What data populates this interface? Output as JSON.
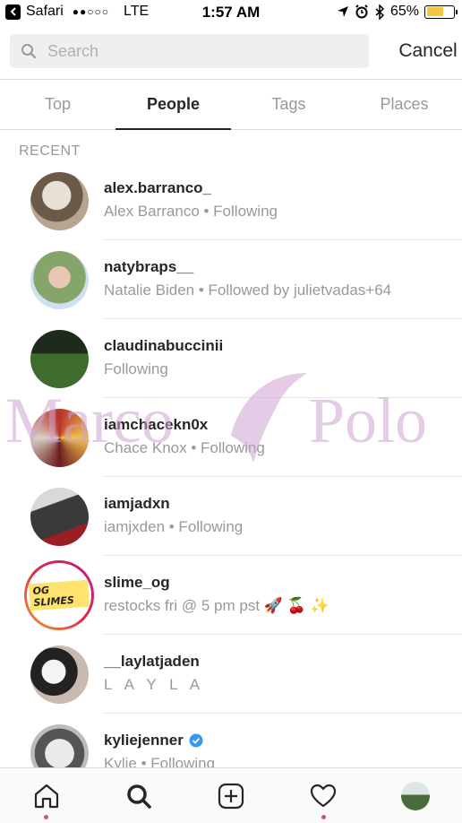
{
  "status_bar": {
    "back_app": "Safari",
    "signal": "●●○○○",
    "network": "LTE",
    "time": "1:57 AM",
    "battery": "65%",
    "battery_level": 0.65,
    "battery_color": "#f5c542"
  },
  "search": {
    "placeholder": "Search",
    "value": "",
    "cancel_label": "Cancel"
  },
  "tabs": [
    {
      "label": "Top",
      "active": false
    },
    {
      "label": "People",
      "active": true
    },
    {
      "label": "Tags",
      "active": false
    },
    {
      "label": "Places",
      "active": false
    }
  ],
  "section_title": "RECENT",
  "results": [
    {
      "username": "alex.barranco_",
      "subtitle": "Alex Barranco • Following",
      "verified": false
    },
    {
      "username": "natybraps__",
      "subtitle": "Natalie Biden • Followed by julietvadas+64",
      "verified": false
    },
    {
      "username": "claudinabuccinii",
      "subtitle": "Following",
      "verified": false
    },
    {
      "username": "iamchacekn0x",
      "subtitle": "Chace Knox • Following",
      "verified": false
    },
    {
      "username": "iamjadxn",
      "subtitle": "iamjxden • Following",
      "verified": false
    },
    {
      "username": "slime_og",
      "subtitle": "restocks fri @ 5 pm pst 🚀 🍒 ✨",
      "verified": false,
      "avatar_text": "OG SLIMES"
    },
    {
      "username": "__laylatjaden",
      "subtitle": "L A Y L A",
      "verified": false
    },
    {
      "username": "kyliejenner",
      "subtitle": "Kylie • Following",
      "verified": true
    }
  ],
  "watermark": {
    "left": "Marco",
    "right": "Polo"
  },
  "bottom_nav": [
    {
      "icon": "home-icon",
      "dot": true
    },
    {
      "icon": "search-icon",
      "dot": false
    },
    {
      "icon": "add-post-icon",
      "dot": false
    },
    {
      "icon": "heart-icon",
      "dot": true
    },
    {
      "icon": "profile-avatar",
      "dot": false
    }
  ],
  "colors": {
    "accent_text": "#262626",
    "muted_text": "#999999",
    "notification_dot": "#ed4956",
    "verified_blue": "#3897f0"
  }
}
